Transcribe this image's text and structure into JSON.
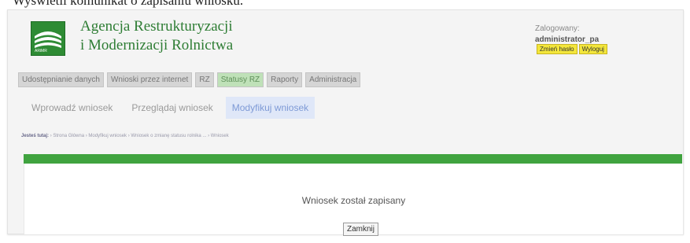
{
  "caption": "Wyświetli komunikat o zapisaniu wniosku.",
  "brand": {
    "line1": "Agencja Restrukturyzacji",
    "line2": "i Modernizacji Rolnictwa",
    "logo_text": "ARiMR"
  },
  "login": {
    "label": "Zalogowany:",
    "user": "administrator_pa",
    "change_password": "Zmień hasło",
    "logout": "Wyloguj"
  },
  "main_menu": [
    {
      "label": "Udostępnianie danych"
    },
    {
      "label": "Wnioski przez internet"
    },
    {
      "label": "RZ"
    },
    {
      "label": "Statusy RZ"
    },
    {
      "label": "Raporty"
    },
    {
      "label": "Administracja"
    }
  ],
  "sub_menu": [
    {
      "label": "Wprowadź wniosek"
    },
    {
      "label": "Przeglądaj wniosek"
    },
    {
      "label": "Modyfikuj wniosek"
    }
  ],
  "breadcrumb": {
    "prefix": "Jesteś tutaj:",
    "path": "› Strona Główna › Modyfikuj wniosek › Wniosek o zmianę statusu rolnika ... › Wniosek"
  },
  "message": "Wniosek został zapisany",
  "close_label": "Zamknij",
  "colors": {
    "brand_green": "#2e7d34",
    "bar_green": "#40a33f",
    "active_tab": "#dfe7f8",
    "login_button": "#f3e63b"
  }
}
